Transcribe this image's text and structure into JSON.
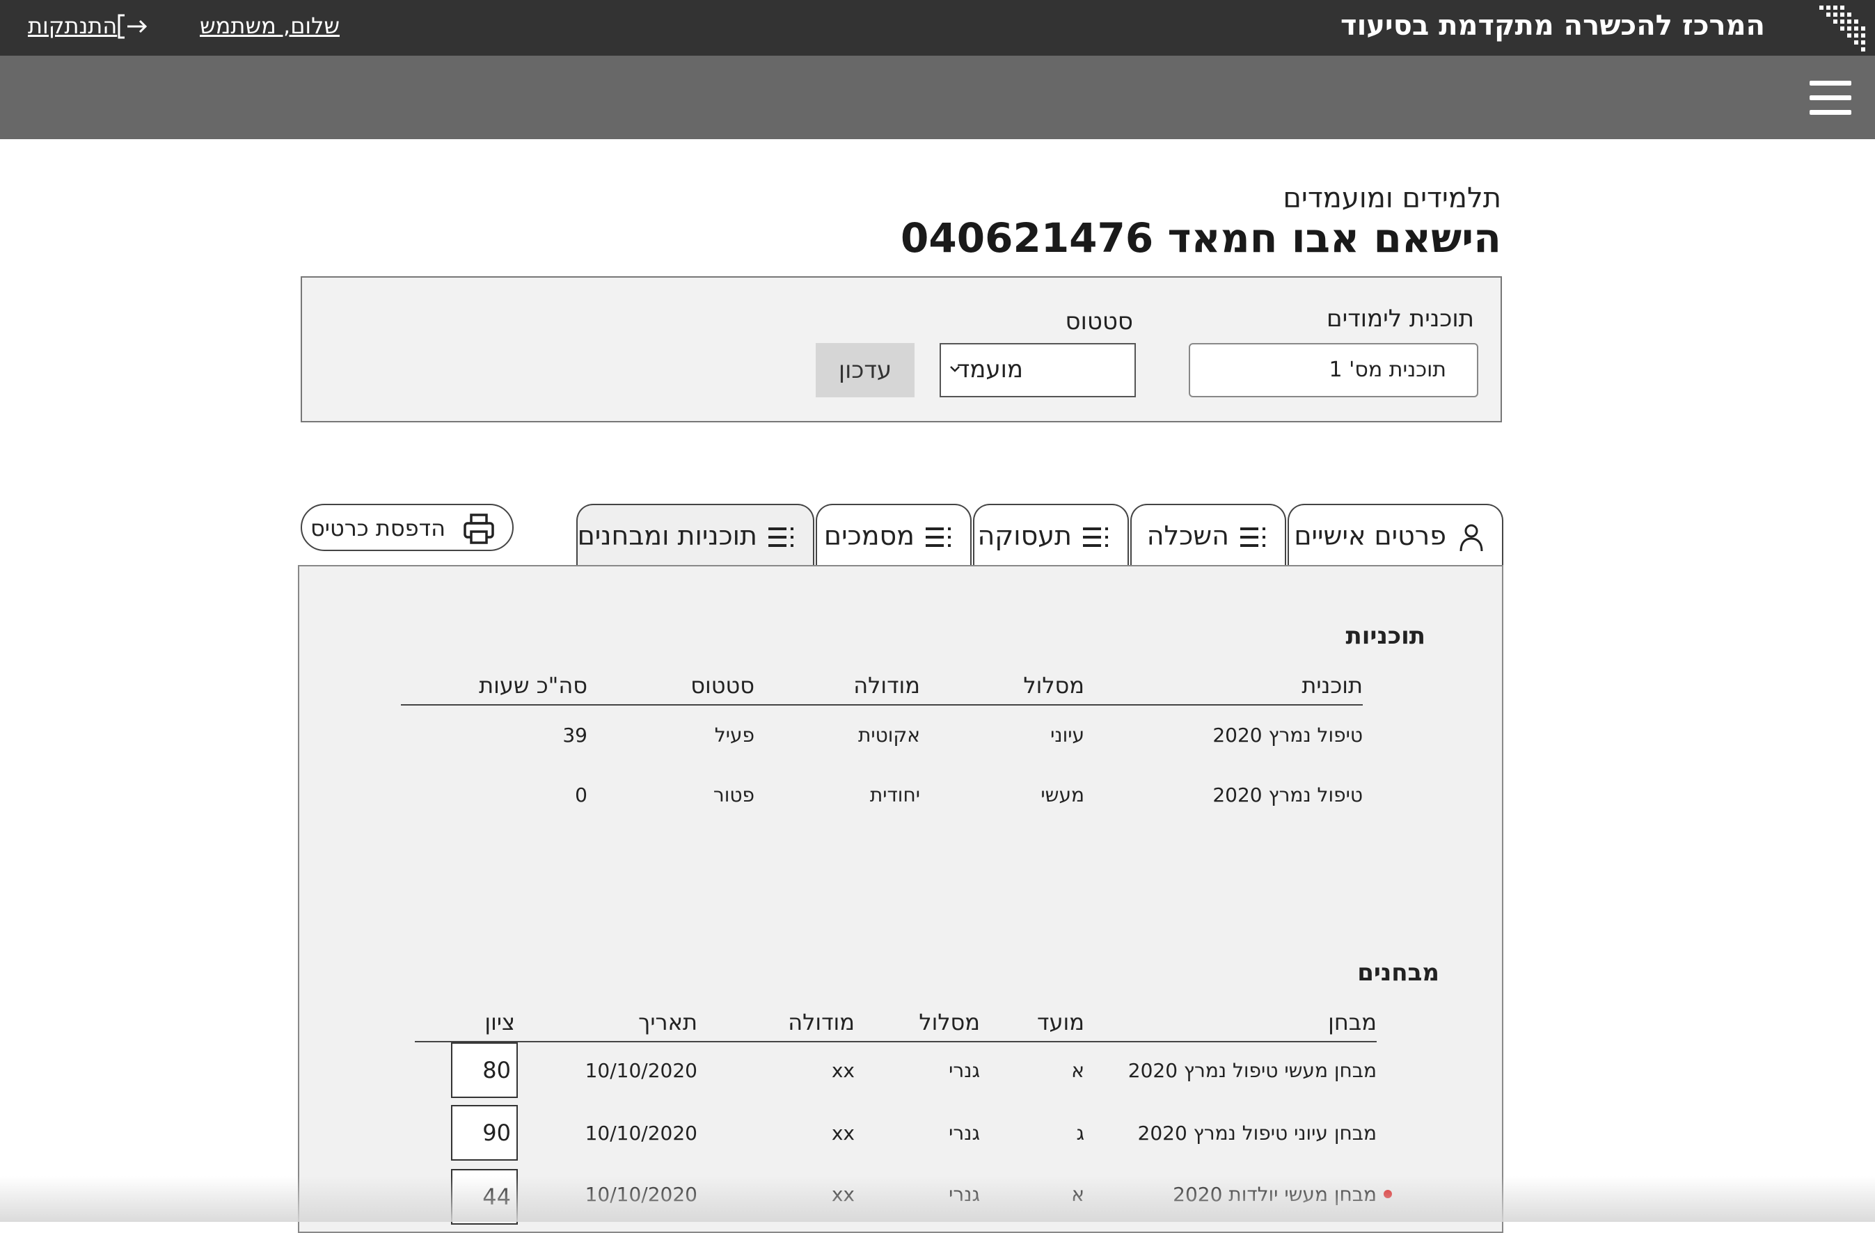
{
  "header": {
    "brand": "המרכז להכשרה מתקדמת בסיעוד",
    "greeting": "שלום, משתמש",
    "logout": "התנתקות"
  },
  "icons": {
    "logo": "dots-logo-icon",
    "logout": "logout-arrow-icon",
    "menu": "hamburger-menu-icon",
    "print": "printer-icon",
    "person": "person-icon",
    "list": "list-icon",
    "chevron": "chevron-down-icon"
  },
  "page": {
    "breadcrumb": "תלמידים ומועמדים",
    "title": "הישאם אבו חמאד 040621476"
  },
  "filters": {
    "program_label": "תוכנית לימודים",
    "program_value": "תוכנית מס' 1",
    "status_label": "סטטוס",
    "status_value": "מועמד",
    "update_label": "עדכון"
  },
  "tabs": {
    "personal": "פרטים אישיים",
    "education": "השכלה",
    "employment": "תעסוקה",
    "documents": "מסמכים",
    "programs_exams": "תוכניות ומבחנים"
  },
  "print_label": "הדפסת כרטיס",
  "programs": {
    "title": "תוכניות",
    "headers": {
      "program": "תוכנית",
      "track": "מסלול",
      "module": "מודולה",
      "status": "סטטוס",
      "hours": "סה\"כ שעות"
    },
    "rows": [
      {
        "program": "טיפול נמרץ 2020",
        "track": "עיוני",
        "module": "אקוטית",
        "status": "פעיל",
        "hours": "39"
      },
      {
        "program": "טיפול נמרץ 2020",
        "track": "מעשי",
        "module": "יחודית",
        "status": "פטור",
        "hours": "0"
      }
    ]
  },
  "exams": {
    "title": "מבחנים",
    "headers": {
      "exam": "מבחן",
      "session": "מועד",
      "track": "מסלול",
      "module": "מודולה",
      "date": "תאריך",
      "grade": "ציון"
    },
    "rows": [
      {
        "exam": "מבחן מעשי טיפול נמרץ 2020",
        "session": "א",
        "track": "גנרי",
        "module": "xx",
        "date": "10/10/2020",
        "grade": "80"
      },
      {
        "exam": "מבחן עיוני טיפול נמרץ 2020",
        "session": "ג",
        "track": "גנרי",
        "module": "xx",
        "date": "10/10/2020",
        "grade": "90"
      },
      {
        "exam": "מבחן מעשי יולדות 2020",
        "session": "א",
        "track": "גנרי",
        "module": "xx",
        "date": "10/10/2020",
        "grade": "44"
      }
    ]
  }
}
